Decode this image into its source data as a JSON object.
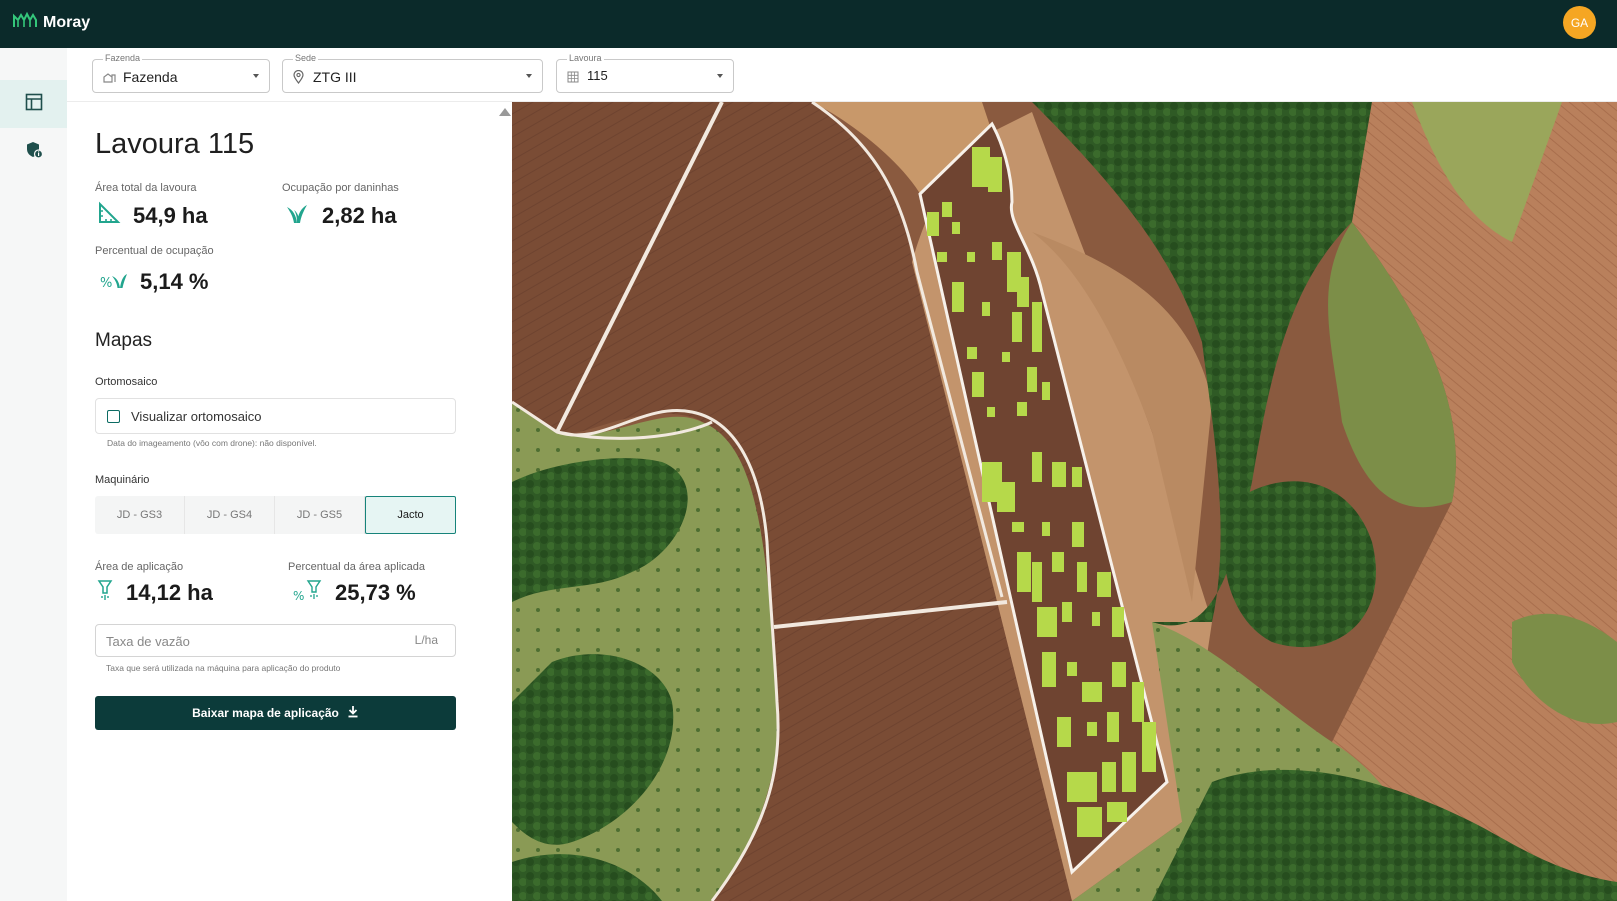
{
  "app": {
    "name": "Moray",
    "user_initials": "GA",
    "brand_color": "#0b2a2a",
    "accent_color": "#16837a",
    "avatar_color": "#f5a623"
  },
  "sidebar": {
    "items": [
      {
        "icon": "layout-icon",
        "active": true
      },
      {
        "icon": "shield-info-icon",
        "active": false
      }
    ]
  },
  "filters": {
    "fazenda": {
      "label": "Fazenda",
      "value": "Fazenda",
      "icon": "farm-icon"
    },
    "sede": {
      "label": "Sede",
      "value": "ZTG III",
      "icon": "location-pin-icon"
    },
    "lavoura": {
      "label": "Lavoura",
      "value": "115",
      "icon": "grid-icon"
    }
  },
  "field": {
    "title": "Lavoura 115",
    "area_total": {
      "label": "Área total da lavoura",
      "value": "54,9 ha",
      "icon": "area-icon"
    },
    "ocupacao": {
      "label": "Ocupação por daninhas",
      "value": "2,82 ha",
      "icon": "weed-icon"
    },
    "percentual": {
      "label": "Percentual de ocupação",
      "value": "5,14 %",
      "icon": "percent-weed-icon"
    }
  },
  "maps": {
    "title": "Mapas",
    "ortho_label": "Ortomosaico",
    "ortho_checkbox": "Visualizar ortomosaico",
    "ortho_checked": false,
    "ortho_helper": "Data do imageamento (vôo com drone): não disponível.",
    "machinery_label": "Maquinário",
    "machines": [
      "JD - GS3",
      "JD - GS4",
      "JD - GS5",
      "Jacto"
    ],
    "selected_machine": "Jacto",
    "area_aplicacao": {
      "label": "Área de aplicação",
      "value": "14,12 ha",
      "icon": "sprayer-icon"
    },
    "percentual_aplicada": {
      "label": "Percentual da área aplicada",
      "value": "25,73 %",
      "icon": "percent-sprayer-icon"
    },
    "rate_placeholder": "Taxa de vazão",
    "rate_unit": "L/ha",
    "rate_helper": "Taxa que será utilizada na máquina para aplicação do produto",
    "download_label": "Baixar mapa de aplicação"
  }
}
